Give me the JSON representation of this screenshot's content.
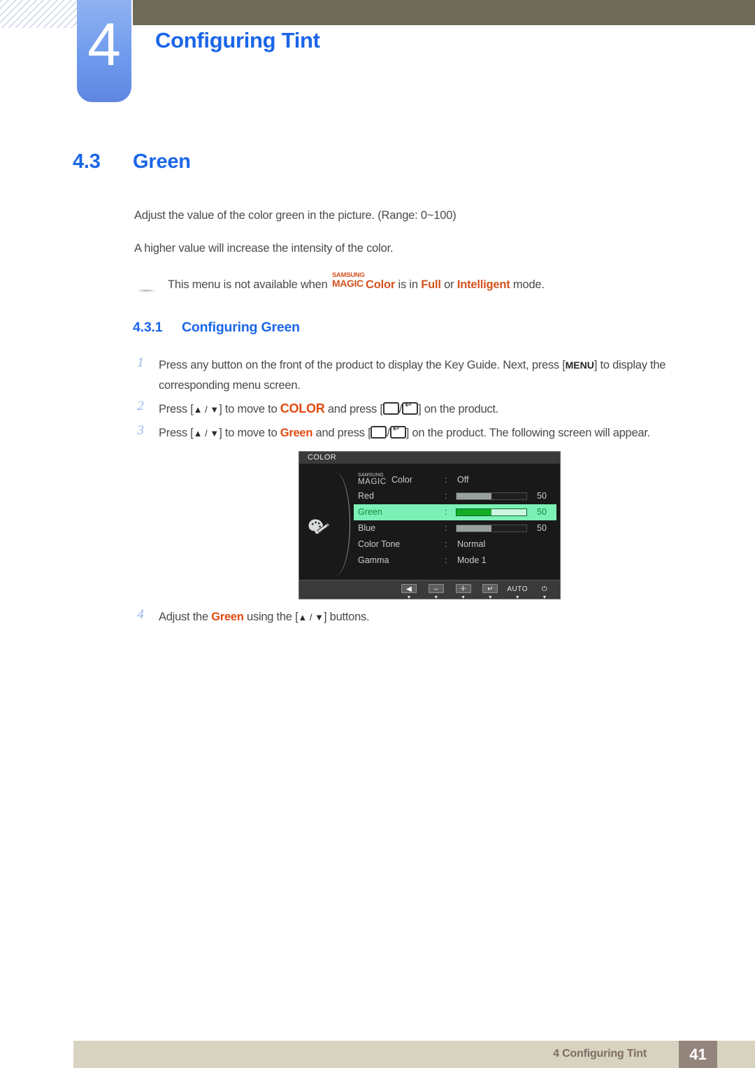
{
  "header": {
    "chapter_number": "4",
    "chapter_title": "Configuring Tint",
    "olive_color": "#6d6b57",
    "tab_color": "#6f9bee",
    "accent_blue": "#1b66e8"
  },
  "section": {
    "number": "4.3",
    "title": "Green",
    "paragraph_1": "Adjust the value of the color green in the picture. (Range: 0~100)",
    "paragraph_2": "A higher value will increase the intensity of the color."
  },
  "note": {
    "text_before": "This menu is not available when",
    "logo_samsung": "SAMSUNG",
    "logo_magic": "MAGIC",
    "logo_color": "Color",
    "text_mid": "is in",
    "mode_1": "Full",
    "text_or": "or",
    "mode_2": "Intelligent",
    "text_after": "mode.",
    "accent_orange": "#d4521f"
  },
  "subsection": {
    "number": "4.3.1",
    "title": "Configuring Green"
  },
  "steps": [
    {
      "num": "1",
      "part_a": "Press any button on the front of the product to display the Key Guide. Next, press [",
      "kbd": "MENU",
      "part_b": "] to display the corresponding menu screen."
    },
    {
      "num": "2",
      "part_a": "Press [",
      "arrows": "▲ / ▼",
      "part_b": "] to move to",
      "highlight": "COLOR",
      "part_c": "and press [",
      "part_d": "] on the product."
    },
    {
      "num": "3",
      "part_a": "Press [",
      "arrows": "▲ / ▼",
      "part_b": "] to move to",
      "highlight": "Green",
      "part_c": "and press [",
      "part_d": "] on the product. The following screen will appear."
    },
    {
      "num": "4",
      "part_a": "Adjust the",
      "highlight": "Green",
      "part_b": "using the [",
      "arrows": "▲ / ▼",
      "part_c": "] buttons."
    }
  ],
  "osd": {
    "title": "COLOR",
    "icon": "palette-icon",
    "rows": [
      {
        "label_samsung": "SAMSUNG",
        "label_magic": "MAGIC",
        "label_color": "Color",
        "colon": ":",
        "value": "Off",
        "type": "text"
      },
      {
        "label": "Red",
        "colon": ":",
        "value": "50",
        "fill_percent": 50,
        "type": "bar",
        "selected": false
      },
      {
        "label": "Green",
        "colon": ":",
        "value": "50",
        "fill_percent": 50,
        "type": "bar",
        "selected": true
      },
      {
        "label": "Blue",
        "colon": ":",
        "value": "50",
        "fill_percent": 50,
        "type": "bar",
        "selected": false
      },
      {
        "label": "Color Tone",
        "colon": ":",
        "value": "Normal",
        "type": "text"
      },
      {
        "label": "Gamma",
        "colon": ":",
        "value": "Mode 1",
        "type": "text"
      }
    ],
    "buttons": [
      {
        "name": "back-button",
        "glyph": "◀",
        "sub": "▼"
      },
      {
        "name": "minus-button",
        "glyph": "–",
        "sub": "▼"
      },
      {
        "name": "plus-button",
        "glyph": "＋",
        "sub": "▼"
      },
      {
        "name": "enter-button",
        "glyph": "↵",
        "sub": "▼"
      },
      {
        "name": "auto-button",
        "glyph": "AUTO",
        "sub": "▼"
      },
      {
        "name": "power-button",
        "glyph": "⏻",
        "sub": "▼"
      }
    ],
    "highlight_color": "#7cf0b6",
    "bar_fill_color": "#13ad26"
  },
  "footer": {
    "text": "4 Configuring Tint",
    "page_number": "41",
    "bar_color": "#d8d3c0",
    "page_box_color": "#93847c"
  }
}
